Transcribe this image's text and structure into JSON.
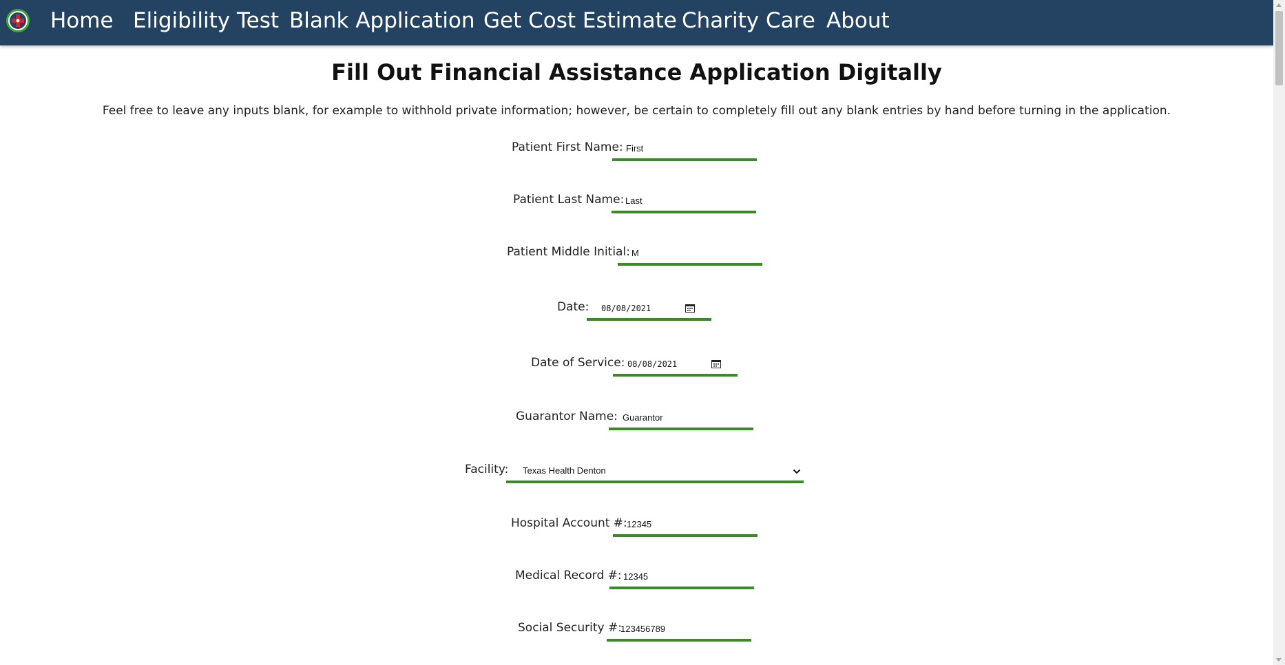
{
  "nav": {
    "logo": "medical-cross-logo-icon",
    "items": [
      "Home",
      "Eligibility Test",
      "Blank Application",
      "Get Cost Estimate",
      "Charity Care",
      "About"
    ]
  },
  "page": {
    "title": "Fill Out Financial Assistance Application Digitally",
    "intro": "Feel free to leave any inputs blank, for example to withhold private information; however, be certain to completely fill out any blank entries by hand before turning in the application."
  },
  "form": {
    "patient_first_name": {
      "label": "Patient First Name:",
      "value": "First"
    },
    "patient_last_name": {
      "label": "Patient Last Name:",
      "value": "Last"
    },
    "patient_middle_initial": {
      "label": "Patient Middle Initial:",
      "value": "M"
    },
    "date": {
      "label": "Date:",
      "value": "08/08/2021"
    },
    "date_of_service": {
      "label": "Date of Service:",
      "value": "08/08/2021"
    },
    "guarantor_name": {
      "label": "Guarantor Name:",
      "value": "Guarantor"
    },
    "facility": {
      "label": "Facility:",
      "value": "Texas Health Denton"
    },
    "hospital_account": {
      "label": "Hospital Account #:",
      "value": "12345"
    },
    "medical_record": {
      "label": "Medical Record #:",
      "value": "12345"
    },
    "social_security": {
      "label": "Social Security #:",
      "value": "123456789"
    }
  },
  "colors": {
    "nav_background": "#244362",
    "input_underline": "#3a8a25",
    "nav_text": "#ffffff"
  }
}
